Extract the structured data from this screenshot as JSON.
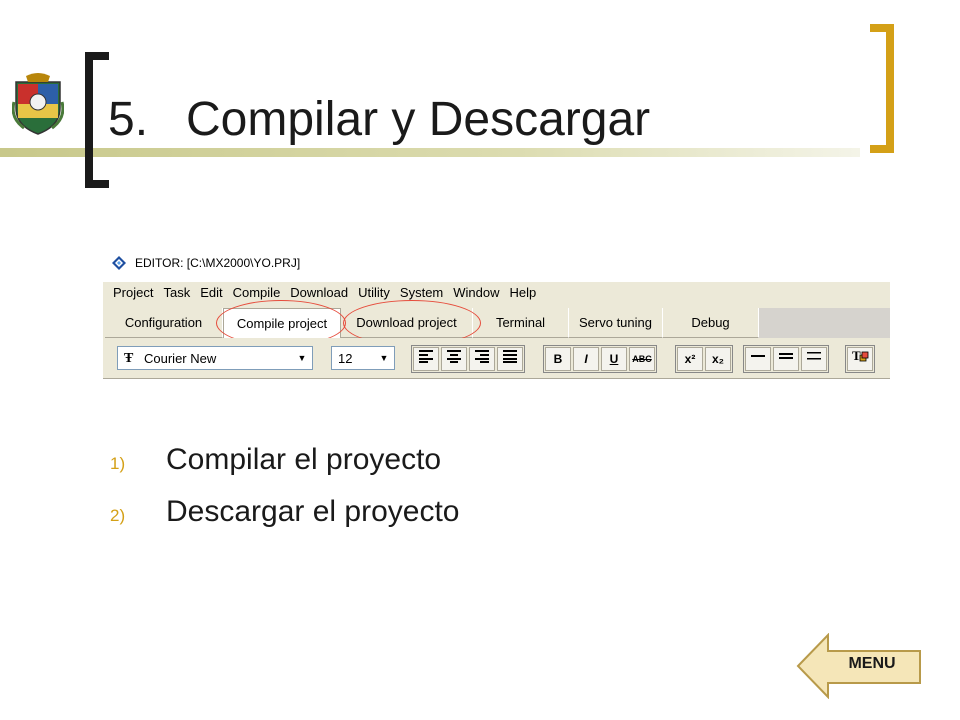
{
  "slide": {
    "number": "5.",
    "title": "Compilar y Descargar"
  },
  "editor": {
    "window_title": "EDITOR: [C:\\MX2000\\YO.PRJ]",
    "menu": [
      "Project",
      "Task",
      "Edit",
      "Compile",
      "Download",
      "Utility",
      "System",
      "Window",
      "Help"
    ],
    "tabs": [
      {
        "label": "Configuration",
        "highlighted": false
      },
      {
        "label": "Compile project",
        "highlighted": true
      },
      {
        "label": "Download project",
        "highlighted": true
      },
      {
        "label": "Terminal",
        "highlighted": false
      },
      {
        "label": "Servo tuning",
        "highlighted": false
      },
      {
        "label": "Debug",
        "highlighted": false
      }
    ],
    "active_tab": "Compile project",
    "toolbar": {
      "font_name": "Courier New",
      "font_size": "12",
      "align_buttons": [
        "align-left-icon",
        "align-center-icon",
        "align-right-icon",
        "align-justify-icon"
      ],
      "style_buttons": [
        {
          "label": "B",
          "name": "bold-button"
        },
        {
          "label": "I",
          "name": "italic-button"
        },
        {
          "label": "U",
          "name": "underline-button"
        },
        {
          "label": "ABC",
          "name": "strikethrough-button"
        }
      ],
      "script_buttons": [
        {
          "label": "x²",
          "name": "superscript-button"
        },
        {
          "label": "x₂",
          "name": "subscript-button"
        }
      ],
      "line_buttons": [
        "line-style-1-icon",
        "line-style-2-icon",
        "line-style-3-icon"
      ],
      "color_button": "text-color-icon"
    },
    "highlight_color": "#e64c3c"
  },
  "steps": [
    {
      "marker": "1)",
      "text": "Compilar el proyecto"
    },
    {
      "marker": "2)",
      "text": "Descargar el proyecto"
    }
  ],
  "nav": {
    "menu_label": "MENU"
  },
  "colors": {
    "accent_gold": "#d4a017",
    "olive_bar": "#c8c88a",
    "menu_button": "#f5e6b8"
  }
}
